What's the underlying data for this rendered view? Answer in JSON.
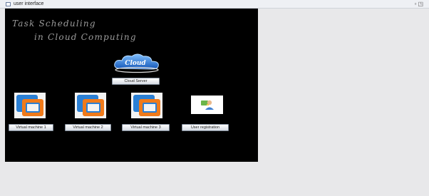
{
  "window": {
    "title": "user interface"
  },
  "banner": {
    "line1": "Task Scheduling",
    "line2": "in Cloud Computing"
  },
  "logo": {
    "text": "Cloud"
  },
  "buttons": {
    "cloud_server": "Cloud Server",
    "vm1": "Virtual machine 1",
    "vm2": "Virtual machine 2",
    "vm3": "Virtual machine 3",
    "user_registration": "User registration"
  },
  "icons": {
    "vm": "virtual-machine-icon",
    "user": "user-registration-icon",
    "logo": "cloud-logo"
  },
  "colors": {
    "panel_bg": "#000000",
    "window_bg": "#e8e8ea",
    "vm_orange": "#f07a1a",
    "vm_blue": "#2a7fd4",
    "cloud_blue": "#1f6fd1"
  }
}
